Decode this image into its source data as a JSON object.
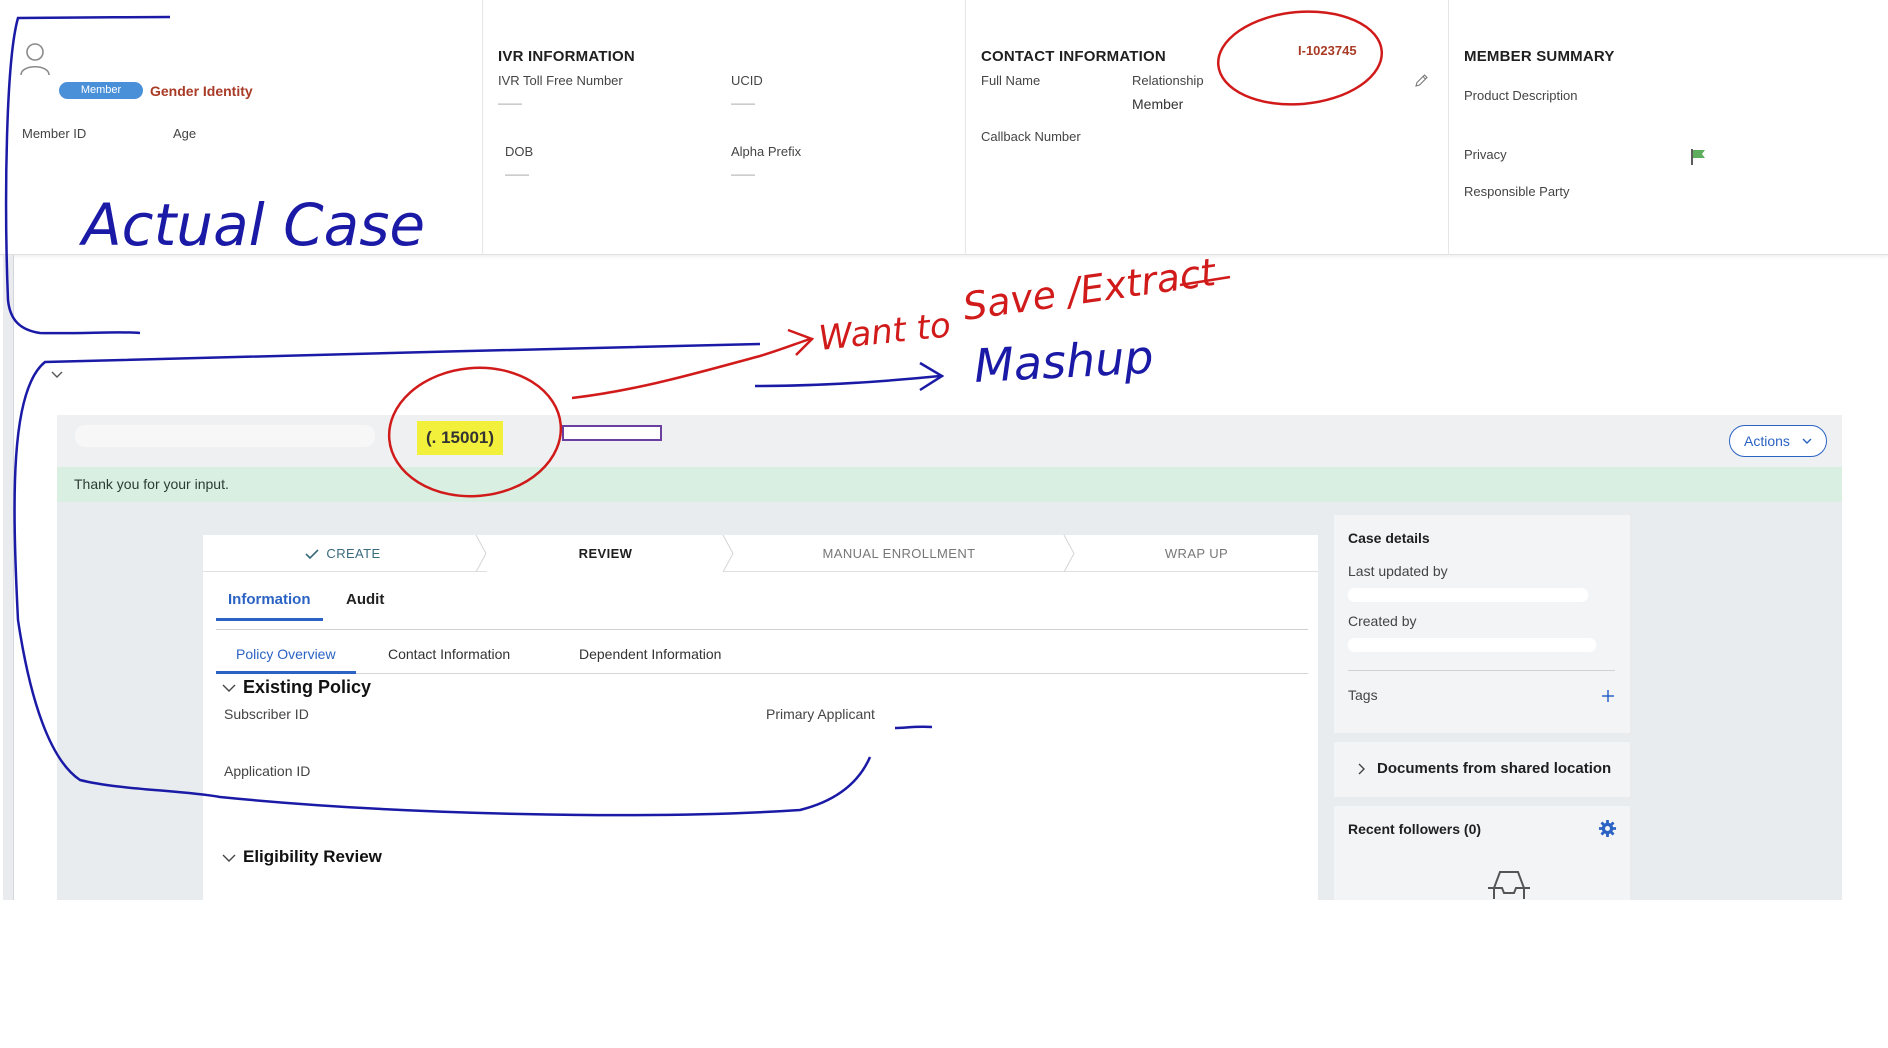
{
  "header": {
    "member_badge": "Member",
    "gender_identity_label": "Gender Identity",
    "member_id_label": "Member ID",
    "age_label": "Age",
    "ivr": {
      "title": "IVR INFORMATION",
      "toll_free_label": "IVR Toll Free Number",
      "ucid_label": "UCID",
      "dob_label": "DOB",
      "alpha_prefix_label": "Alpha Prefix",
      "empty_value": "——"
    },
    "contact": {
      "title": "CONTACT INFORMATION",
      "full_name_label": "Full Name",
      "relationship_label": "Relationship",
      "relationship_value": "Member",
      "callback_label": "Callback Number",
      "case_reference": "I-1023745"
    },
    "summary": {
      "title": "MEMBER SUMMARY",
      "product_label": "Product Description",
      "privacy_label": "Privacy",
      "responsible_label": "Responsible Party"
    }
  },
  "case": {
    "id_text": "(.        15001)",
    "actions_label": "Actions",
    "success_message": "Thank you for your input.",
    "stages": [
      {
        "label": "CREATE",
        "state": "done"
      },
      {
        "label": "REVIEW",
        "state": "active"
      },
      {
        "label": "MANUAL ENROLLMENT",
        "state": "pending"
      },
      {
        "label": "WRAP UP",
        "state": "pending"
      }
    ],
    "tabs": [
      {
        "label": "Information",
        "active": true
      },
      {
        "label": "Audit",
        "active": false
      }
    ],
    "subtabs": [
      {
        "label": "Policy Overview",
        "active": true
      },
      {
        "label": "Contact Information",
        "active": false
      },
      {
        "label": "Dependent Information",
        "active": false
      }
    ],
    "existing_policy": {
      "title": "Existing Policy",
      "subscriber_id_label": "Subscriber ID",
      "primary_applicant_label": "Primary Applicant",
      "application_id_label": "Application ID"
    },
    "eligibility_review_title": "Eligibility Review"
  },
  "side": {
    "case_details_title": "Case details",
    "last_updated_label": "Last updated by",
    "created_by_label": "Created by",
    "tags_label": "Tags",
    "documents_title": "Documents from shared location",
    "followers_title": "Recent followers (0)"
  },
  "annotations": {
    "actual_case": "Actual Case",
    "want_to": "Want to",
    "save_extract": "Save /Extract",
    "mashup": "Mashup"
  },
  "colors": {
    "accent": "#2b63c4",
    "case_ref": "#a83a26",
    "success_bg": "#d9efe2",
    "highlight": "#f3f03b",
    "annotation_blue": "#1a1aa6",
    "annotation_red": "#d11a1a"
  },
  "icons": [
    "user-icon",
    "pencil-icon",
    "flag-icon",
    "chevron-down-icon",
    "check-icon",
    "plus-icon",
    "gear-icon",
    "chevron-right-icon",
    "empty-followers-icon"
  ]
}
